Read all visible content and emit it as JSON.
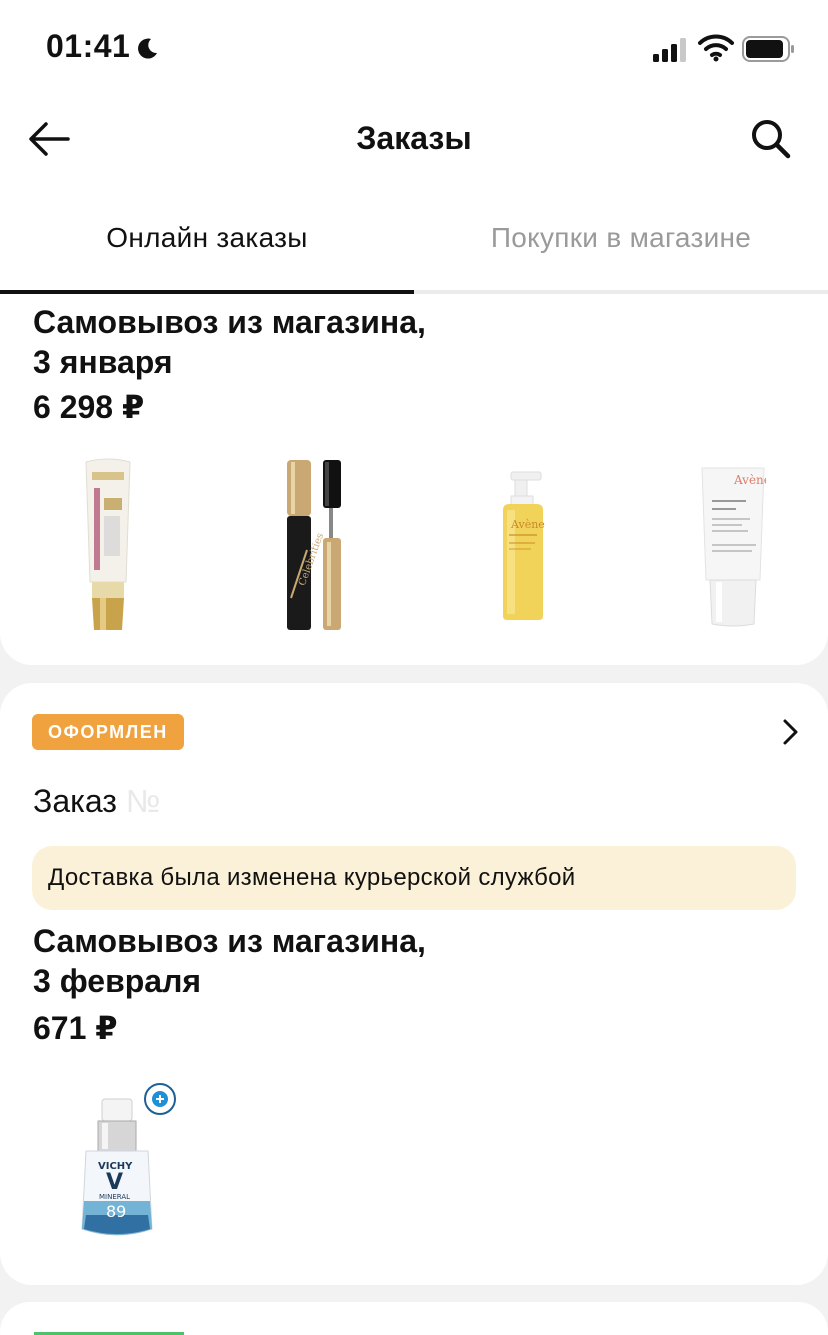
{
  "status_bar": {
    "time": "01:41"
  },
  "header": {
    "title": "Заказы"
  },
  "tabs": [
    {
      "label": "Онлайн заказы",
      "active": true
    },
    {
      "label": "Покупки в магазине",
      "active": false
    }
  ],
  "orders": [
    {
      "delivery_line1": "Самовывоз из магазина,",
      "delivery_line2": "3 января",
      "price": "6 298 ₽",
      "products": [
        "L'Oreal Возраст Эксперт 55+ tube",
        "Eveline Celebrities mascara",
        "Avène XeraCalm A.D cleansing oil",
        "Avène XeraCalm A.D balm"
      ]
    },
    {
      "status": "ОФОРМЛЕН",
      "status_color": "#f0a23e",
      "order_label": "Заказ",
      "order_number_hidden": "№",
      "notice": "Доставка была изменена курьерской службой",
      "delivery_line1": "Самовывоз из магазина,",
      "delivery_line2": "3 февраля",
      "price": "671 ₽",
      "products": [
        "Vichy Minéral 89 serum"
      ]
    }
  ]
}
